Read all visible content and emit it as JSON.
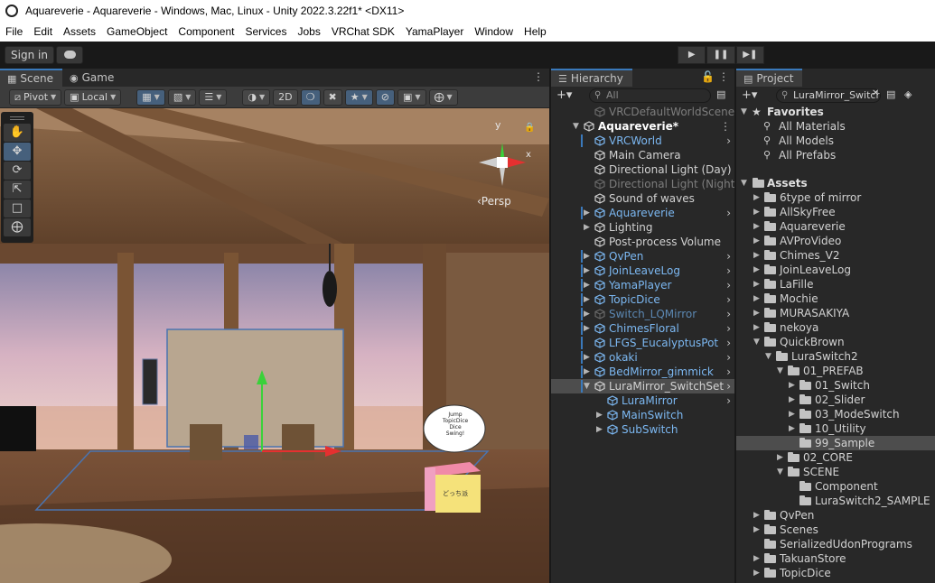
{
  "window": {
    "title": "Aquareverie - Aquareverie - Windows, Mac, Linux - Unity 2022.3.22f1* <DX11>"
  },
  "menu": [
    "File",
    "Edit",
    "Assets",
    "GameObject",
    "Component",
    "Services",
    "Jobs",
    "VRChat SDK",
    "YamaPlayer",
    "Window",
    "Help"
  ],
  "toolbar": {
    "sign_in": "Sign in",
    "play_icon": "play-icon",
    "pause_icon": "pause-icon",
    "step_icon": "step-icon"
  },
  "scene_panel": {
    "tabs": [
      {
        "label": "Scene",
        "icon": "scene-icon",
        "active": true
      },
      {
        "label": "Game",
        "icon": "game-icon",
        "active": false
      }
    ],
    "pivot_label": "Pivot",
    "local_label": "Local",
    "mode_2d": "2D",
    "persp_label": "‹Persp",
    "gizmo_y": "y",
    "gizmo_x": "x",
    "sign_text": [
      "Jump",
      "TopicDice",
      "Dice",
      "Swing!"
    ],
    "cube_text": "どっち派"
  },
  "hierarchy": {
    "tab_label": "Hierarchy",
    "search_placeholder": "All",
    "items": [
      {
        "label": "VRCDefaultWorldScene",
        "depth": 1,
        "arrow": "",
        "style": "dim",
        "bar": false,
        "chevron": false
      },
      {
        "label": "Aquareverie*",
        "depth": 0,
        "arrow": "▼",
        "style": "bold",
        "bar": false,
        "chevron": false
      },
      {
        "label": "VRCWorld",
        "depth": 1,
        "arrow": "",
        "style": "blue",
        "bar": true,
        "chevron": true
      },
      {
        "label": "Main Camera",
        "depth": 1,
        "arrow": "",
        "style": "normal",
        "bar": false,
        "chevron": false
      },
      {
        "label": "Directional Light (Day)",
        "depth": 1,
        "arrow": "",
        "style": "normal",
        "bar": false,
        "chevron": false
      },
      {
        "label": "Directional Light (Night)",
        "depth": 1,
        "arrow": "",
        "style": "dim",
        "bar": false,
        "chevron": false
      },
      {
        "label": "Sound of waves",
        "depth": 1,
        "arrow": "",
        "style": "normal",
        "bar": false,
        "chevron": false
      },
      {
        "label": "Aquareverie",
        "depth": 1,
        "arrow": "▶",
        "style": "blue",
        "bar": true,
        "chevron": true
      },
      {
        "label": "Lighting",
        "depth": 1,
        "arrow": "▶",
        "style": "normal",
        "bar": false,
        "chevron": false
      },
      {
        "label": "Post-process Volume",
        "depth": 1,
        "arrow": "",
        "style": "normal",
        "bar": false,
        "chevron": false
      },
      {
        "label": "QvPen",
        "depth": 1,
        "arrow": "▶",
        "style": "blue",
        "bar": true,
        "chevron": true
      },
      {
        "label": "JoinLeaveLog",
        "depth": 1,
        "arrow": "▶",
        "style": "blue",
        "bar": true,
        "chevron": true
      },
      {
        "label": "YamaPlayer",
        "depth": 1,
        "arrow": "▶",
        "style": "blue",
        "bar": true,
        "chevron": true
      },
      {
        "label": "TopicDice",
        "depth": 1,
        "arrow": "▶",
        "style": "blue",
        "bar": true,
        "chevron": true
      },
      {
        "label": "Switch_LQMirror",
        "depth": 1,
        "arrow": "▶",
        "style": "dimblue",
        "bar": true,
        "chevron": true
      },
      {
        "label": "ChimesFloral",
        "depth": 1,
        "arrow": "▶",
        "style": "blue",
        "bar": true,
        "chevron": true
      },
      {
        "label": "LFGS_EucalyptusPot",
        "depth": 1,
        "arrow": "",
        "style": "blue",
        "bar": true,
        "chevron": true
      },
      {
        "label": "okaki",
        "depth": 1,
        "arrow": "▶",
        "style": "blue",
        "bar": true,
        "chevron": true
      },
      {
        "label": "BedMirror_gimmick",
        "depth": 1,
        "arrow": "▶",
        "style": "blue",
        "bar": true,
        "chevron": true
      },
      {
        "label": "LuraMirror_SwitchSet",
        "depth": 1,
        "arrow": "▼",
        "style": "normal",
        "bar": true,
        "chevron": true,
        "selected": true
      },
      {
        "label": "LuraMirror",
        "depth": 2,
        "arrow": "",
        "style": "blue",
        "bar": false,
        "chevron": true
      },
      {
        "label": "MainSwitch",
        "depth": 2,
        "arrow": "▶",
        "style": "blue",
        "bar": false,
        "chevron": false
      },
      {
        "label": "SubSwitch",
        "depth": 2,
        "arrow": "▶",
        "style": "blue",
        "bar": false,
        "chevron": false
      }
    ]
  },
  "project": {
    "tab_label": "Project",
    "search_value": "LuraMirror_Switch",
    "favorites_label": "Favorites",
    "favorites": [
      "All Materials",
      "All Models",
      "All Prefabs"
    ],
    "assets_label": "Assets",
    "items": [
      {
        "label": "6type of mirror",
        "depth": 1,
        "arrow": "▶"
      },
      {
        "label": "AllSkyFree",
        "depth": 1,
        "arrow": "▶"
      },
      {
        "label": "Aquareverie",
        "depth": 1,
        "arrow": "▶"
      },
      {
        "label": "AVProVideo",
        "depth": 1,
        "arrow": "▶"
      },
      {
        "label": "Chimes_V2",
        "depth": 1,
        "arrow": "▶"
      },
      {
        "label": "JoinLeaveLog",
        "depth": 1,
        "arrow": "▶"
      },
      {
        "label": "LaFille",
        "depth": 1,
        "arrow": "▶"
      },
      {
        "label": "Mochie",
        "depth": 1,
        "arrow": "▶"
      },
      {
        "label": "MURASAKIYA",
        "depth": 1,
        "arrow": "▶"
      },
      {
        "label": "nekoya",
        "depth": 1,
        "arrow": "▶"
      },
      {
        "label": "QuickBrown",
        "depth": 1,
        "arrow": "▼"
      },
      {
        "label": "LuraSwitch2",
        "depth": 2,
        "arrow": "▼"
      },
      {
        "label": "01_PREFAB",
        "depth": 3,
        "arrow": "▼"
      },
      {
        "label": "01_Switch",
        "depth": 4,
        "arrow": "▶"
      },
      {
        "label": "02_Slider",
        "depth": 4,
        "arrow": "▶"
      },
      {
        "label": "03_ModeSwitch",
        "depth": 4,
        "arrow": "▶"
      },
      {
        "label": "10_Utility",
        "depth": 4,
        "arrow": "▶"
      },
      {
        "label": "99_Sample",
        "depth": 4,
        "arrow": "",
        "selected": true
      },
      {
        "label": "02_CORE",
        "depth": 3,
        "arrow": "▶"
      },
      {
        "label": "SCENE",
        "depth": 3,
        "arrow": "▼"
      },
      {
        "label": "Component",
        "depth": 4,
        "arrow": ""
      },
      {
        "label": "LuraSwitch2_SAMPLE",
        "depth": 4,
        "arrow": ""
      },
      {
        "label": "QvPen",
        "depth": 1,
        "arrow": "▶"
      },
      {
        "label": "Scenes",
        "depth": 1,
        "arrow": "▶"
      },
      {
        "label": "SerializedUdonPrograms",
        "depth": 1,
        "arrow": ""
      },
      {
        "label": "TakuanStore",
        "depth": 1,
        "arrow": "▶"
      },
      {
        "label": "TopicDice",
        "depth": 1,
        "arrow": "▶"
      }
    ]
  },
  "colors": {
    "accent_blue": "#3a79bb",
    "prefab_blue": "#7cb8f2",
    "panel_bg": "#282828",
    "toolbar_bg": "#3c3c3c"
  }
}
